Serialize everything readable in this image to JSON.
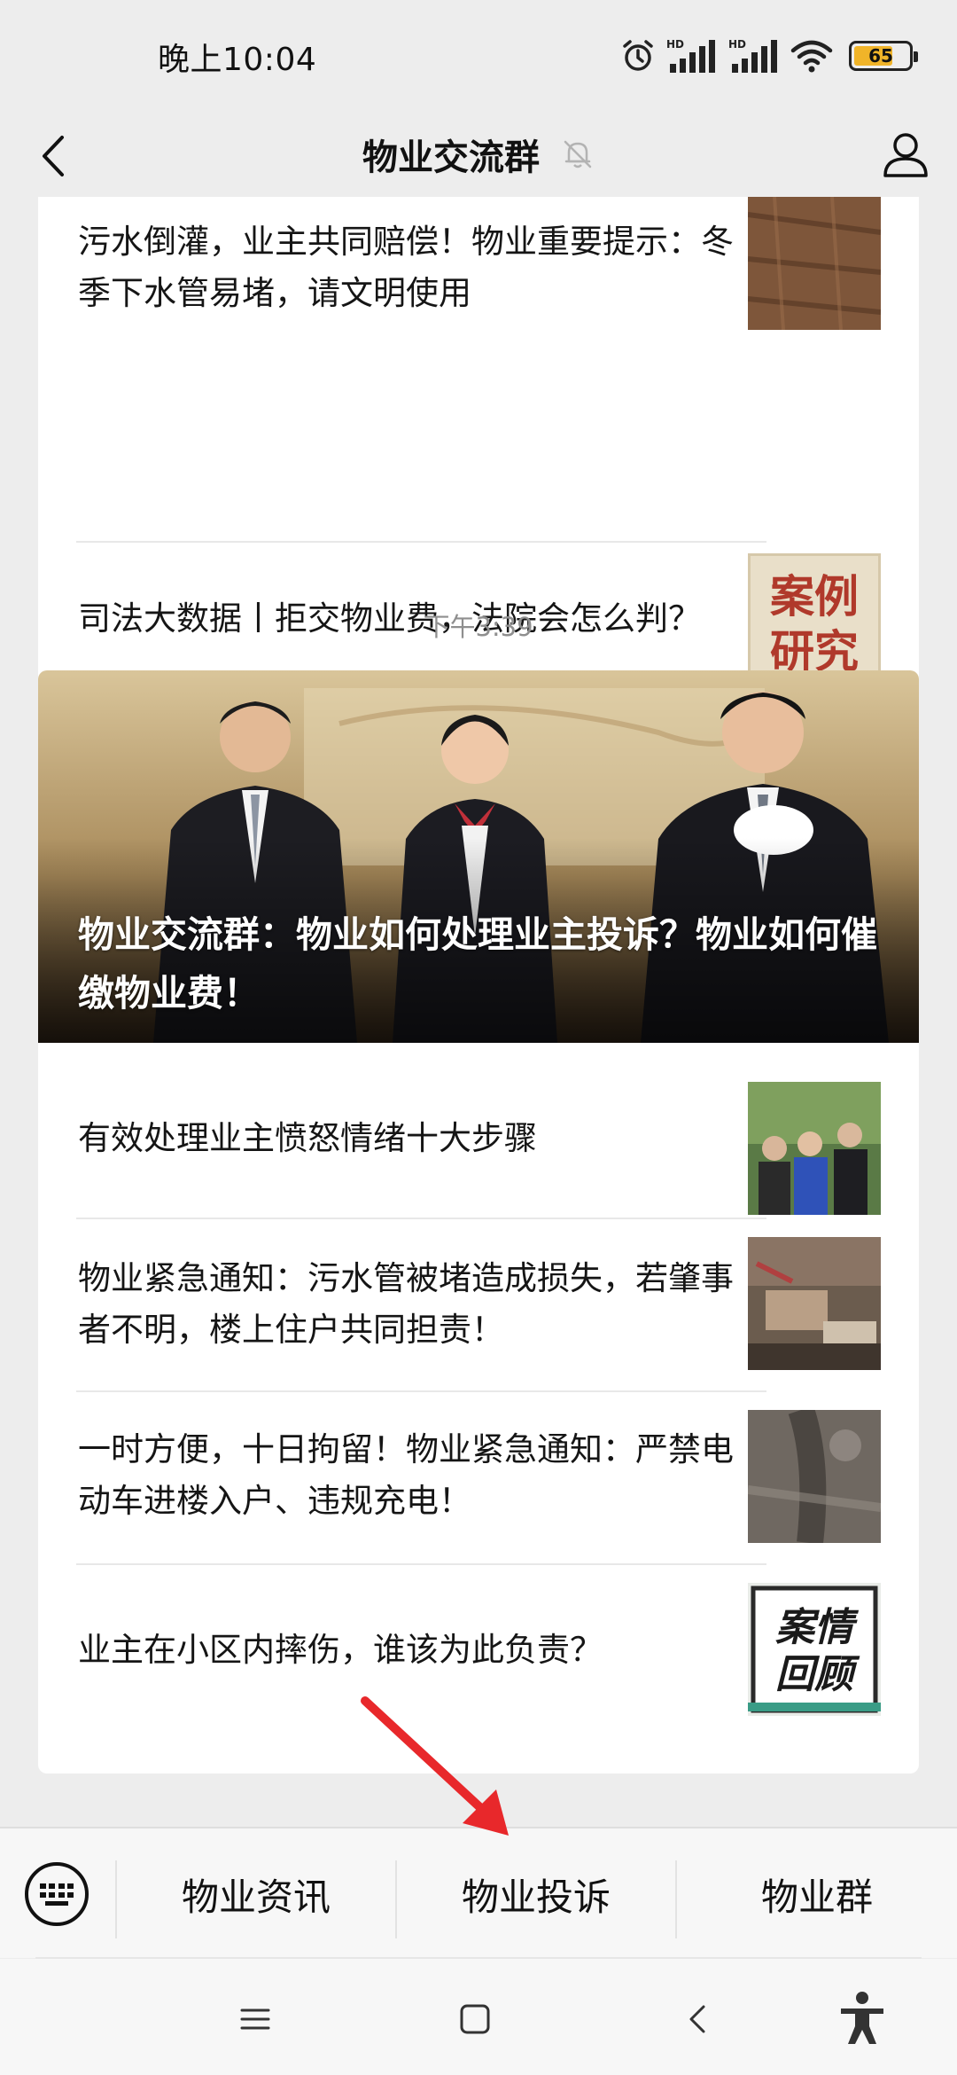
{
  "status_bar": {
    "time": "晚上10:04",
    "battery_level": "65",
    "icons": [
      "alarm-icon",
      "hd-signal-icon",
      "hd-signal-icon",
      "wifi-icon",
      "battery-icon"
    ]
  },
  "header": {
    "title": "物业交流群",
    "back_icon": "chevron-left-icon",
    "mute_icon": "bell-muted-icon",
    "profile_icon": "person-icon"
  },
  "chat": {
    "top_card": {
      "articles": [
        {
          "title": "污水倒灌，业主共同赔偿！物业重要提示：冬季下水管易堵，请文明使用"
        },
        {
          "title": "司法大数据丨拒交物业费，法院会怎么判？",
          "thumb_text": "案例研究"
        }
      ]
    },
    "timestamp": "下午3:39",
    "main_card": {
      "hero_title": "物业交流群：物业如何处理业主投诉？物业如何催缴物业费！",
      "articles": [
        {
          "title": "有效处理业主愤怒情绪十大步骤"
        },
        {
          "title": "物业紧急通知：污水管被堵造成损失，若肇事者不明，楼上住户共同担责！"
        },
        {
          "title": "一时方便，十日拘留！物业紧急通知：严禁电动车进楼入户、违规充电！"
        },
        {
          "title": "业主在小区内摔伤，谁该为此负责？",
          "thumb_text": "案情回顾"
        }
      ]
    }
  },
  "menu": {
    "keyboard_icon": "keyboard-icon",
    "items": [
      {
        "label": "物业资讯"
      },
      {
        "label": "物业投诉"
      },
      {
        "label": "物业群"
      }
    ]
  },
  "system_nav": {
    "icons": [
      "menu-icon",
      "home-icon",
      "back-icon",
      "accessibility-icon"
    ]
  },
  "colors": {
    "background": "#ededed",
    "card": "#ffffff",
    "annotation_arrow": "#e8282b",
    "battery": "#f0b429"
  }
}
